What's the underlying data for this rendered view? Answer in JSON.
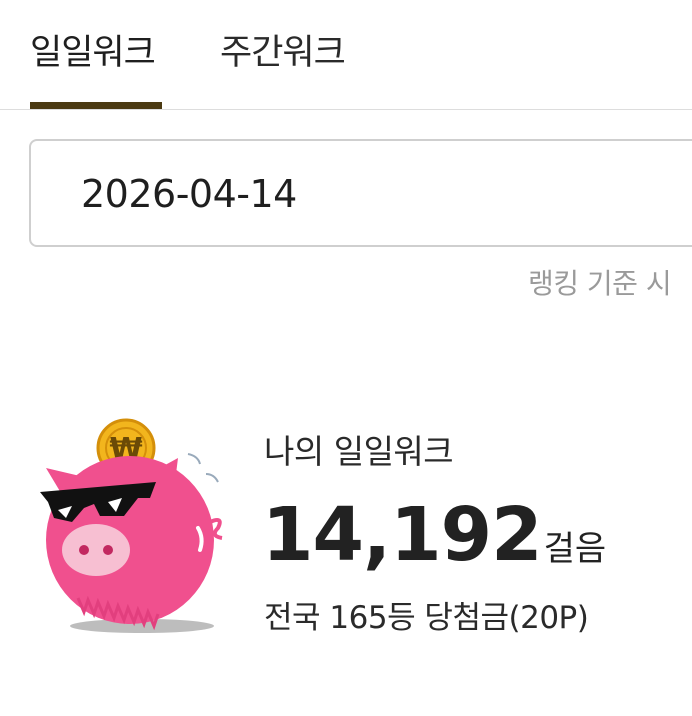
{
  "tabs": [
    {
      "label": "일일워크",
      "active": true
    },
    {
      "label": "주간워크",
      "active": false
    }
  ],
  "date_field": {
    "value": "2026-04-14"
  },
  "ranking_note": "랭킹 기준 시",
  "summary": {
    "title": "나의 일일워크",
    "steps": "14,192",
    "steps_unit": "걸음",
    "rank_text": "전국 165등 당첨금(20P)"
  },
  "mascot": {
    "icon": "pig-coin-icon",
    "coin_symbol": "₩"
  },
  "colors": {
    "tab_indicator": "#4b3a12",
    "pig_pink": "#f0508e",
    "coin_gold": "#f2b51d"
  }
}
